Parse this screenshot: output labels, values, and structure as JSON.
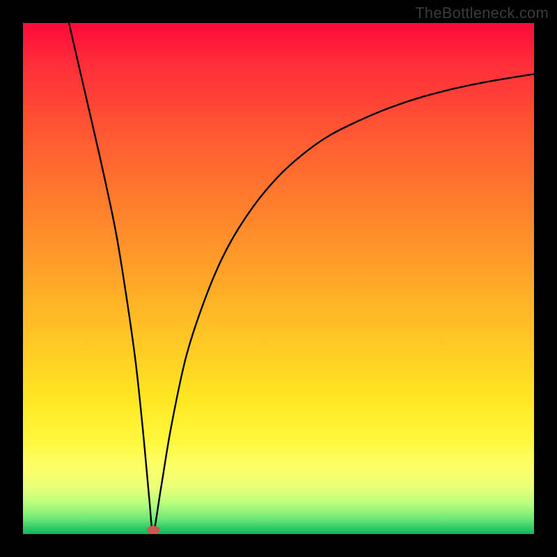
{
  "watermark": "TheBottleneck.com",
  "chart_data": {
    "type": "line",
    "title": "",
    "xlabel": "",
    "ylabel": "",
    "xlim": [
      0,
      100
    ],
    "ylim": [
      0,
      100
    ],
    "grid": false,
    "legend": false,
    "series": [
      {
        "name": "curve",
        "x": [
          9,
          12,
          15,
          18,
          20,
          22,
          23.5,
          24.7,
          25.5,
          27,
          29,
          32,
          36,
          40,
          45,
          50,
          55,
          60,
          66,
          72,
          78,
          85,
          92,
          100
        ],
        "values": [
          100,
          87,
          74,
          60,
          48,
          34,
          20,
          7,
          0.5,
          9,
          21,
          35,
          47,
          56,
          64,
          70,
          74.5,
          78,
          81,
          83.5,
          85.5,
          87.3,
          88.7,
          90
        ]
      }
    ],
    "marker": {
      "name": "minimum-marker",
      "x": 25.5,
      "y": 0.8,
      "color": "#c95a4e"
    },
    "background_gradient": {
      "top": "#ff0a3a",
      "upper_mid": "#ff9a29",
      "mid": "#ffe822",
      "lower_mid": "#fdff6a",
      "bottom": "#0fb85c"
    }
  }
}
